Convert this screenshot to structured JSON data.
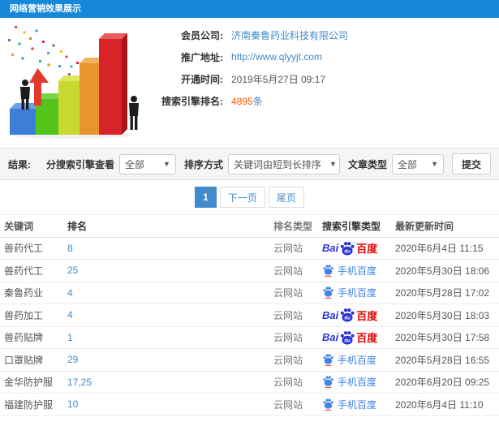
{
  "titlebar": {
    "title": "网络营销效果展示"
  },
  "info": {
    "fields": [
      {
        "label": "会员公司:",
        "value": "济南秦鲁药业科技有限公司",
        "type": "link"
      },
      {
        "label": "推广地址:",
        "value": "http://www.qlyyjt.com",
        "type": "link"
      },
      {
        "label": "开通时间:",
        "value": "2019年5月27日 09:17",
        "type": "text"
      },
      {
        "label": "搜索引擎排名:",
        "value": "4895",
        "suffix": "条",
        "type": "count"
      }
    ]
  },
  "filters": {
    "result_label": "结果:",
    "engine_label": "分搜索引擎查看",
    "engine_value": "全部",
    "sort_label": "排序方式",
    "sort_value": "关键词由短到长排序",
    "article_label": "文章类型",
    "article_value": "全部",
    "submit_label": "提交",
    "caret": "▼"
  },
  "pagination": {
    "current": "1",
    "next": "下一页",
    "last": "尾页"
  },
  "table": {
    "headers": [
      "关键词",
      "排名",
      "排名类型",
      "搜索引擎类型",
      "最新更新时间"
    ],
    "engine_labels": {
      "baidu_pc_prefix": "Bai",
      "baidu_du": "du",
      "baidu_pc_suffix": "百度",
      "baidu_mobile": "手机百度"
    },
    "rows": [
      {
        "keyword": "兽药代工",
        "rank": "8",
        "rank_type": "云网站",
        "engine": "baidu-pc",
        "updated": "2020年6月4日 11:15"
      },
      {
        "keyword": "兽药代工",
        "rank": "25",
        "rank_type": "云网站",
        "engine": "baidu-mobile",
        "updated": "2020年5月30日 18:06"
      },
      {
        "keyword": "秦鲁药业",
        "rank": "4",
        "rank_type": "云网站",
        "engine": "baidu-mobile",
        "updated": "2020年5月28日 17:02"
      },
      {
        "keyword": "兽药加工",
        "rank": "4",
        "rank_type": "云网站",
        "engine": "baidu-pc",
        "updated": "2020年5月30日 18:03"
      },
      {
        "keyword": "兽药贴牌",
        "rank": "1",
        "rank_type": "云网站",
        "engine": "baidu-pc",
        "updated": "2020年5月30日 17:58"
      },
      {
        "keyword": "口罩贴牌",
        "rank": "29",
        "rank_type": "云网站",
        "engine": "baidu-mobile",
        "updated": "2020年5月28日 16:55"
      },
      {
        "keyword": "金华防护服",
        "rank": "17,25",
        "rank_type": "云网站",
        "engine": "baidu-mobile",
        "updated": "2020年6月20日 09:25"
      },
      {
        "keyword": "福建防护服",
        "rank": "10",
        "rank_type": "云网站",
        "engine": "baidu-mobile",
        "updated": "2020年6月4日 11:10"
      }
    ]
  },
  "colors": {
    "header_blue": "#1687d9",
    "link_blue": "#428bca",
    "count_red": "#ff5500",
    "baidu_blue": "#2932d8",
    "baidu_red": "#e10602",
    "mobile_baidu_blue": "#3f83e8"
  }
}
